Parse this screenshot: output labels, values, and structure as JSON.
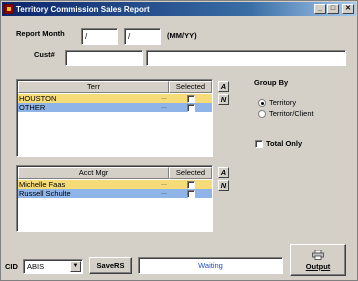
{
  "window": {
    "title": "Territory Commission Sales Report",
    "buttons": {
      "minimize": "_",
      "maximize": "□",
      "close": "✕"
    }
  },
  "form": {
    "report_month_label": "Report Month",
    "month_value": "/",
    "year_value": "/",
    "format_hint": "(MM/YY)",
    "cust_label": "Cust#",
    "cust_value": "",
    "cust_name_value": ""
  },
  "terr_grid": {
    "columns": [
      "Terr",
      "Selected"
    ],
    "rows": [
      {
        "name": "HOUSTON",
        "dots": "...",
        "selected": false,
        "highlight": "yellow"
      },
      {
        "name": "OTHER",
        "dots": "...",
        "selected": false,
        "highlight": "blue"
      }
    ],
    "btn_all": "A",
    "btn_none": "N"
  },
  "acct_grid": {
    "columns": [
      "Acct Mgr",
      "Selected"
    ],
    "rows": [
      {
        "name": "Michelle Faas",
        "dots": "...",
        "selected": false,
        "highlight": "yellow"
      },
      {
        "name": "Russell Schulte",
        "dots": "...",
        "selected": false,
        "highlight": "blue"
      }
    ],
    "btn_all": "A",
    "btn_none": "N"
  },
  "group_by": {
    "label": "Group By",
    "options": [
      {
        "label": "Territory",
        "selected": true
      },
      {
        "label": "Territor/Client",
        "selected": false
      }
    ]
  },
  "total_only": {
    "label": "Total Only",
    "checked": false
  },
  "footer": {
    "cid_label": "CID",
    "cid_value": "ABIS",
    "savers_label": "SaveRS",
    "status_text": "Waiting",
    "output_label": "Output"
  }
}
